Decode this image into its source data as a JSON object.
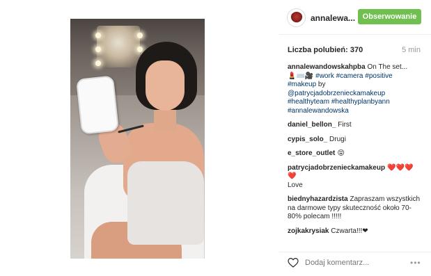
{
  "post": {
    "username": "annalewa...",
    "follow_label": "Obserwowanie",
    "likes_label": "Liczba polubień: 370",
    "time": "5 min",
    "caption": {
      "user": "annalewandowskahpba",
      "text_pre": " On The set...",
      "emojis": "💄⌨️🎥",
      "tags1": " #work #camera #positive",
      "tags2": "#makeup",
      "text_by": " by",
      "mention": "@patrycjadobrzenieckamakeup",
      "tags3": "#healthyteam #healthyplanbyann",
      "tags4": "#annalewandowska"
    },
    "comments": [
      {
        "user": "daniel_bellon_",
        "text": " First"
      },
      {
        "user": "cypis_solo_",
        "text": " Drugi"
      },
      {
        "user": "e_store_outlet",
        "text": " 😝"
      },
      {
        "user": "patrycjadobrzenieckamakeup",
        "text": " ❤️❤️❤️❤️",
        "text2": "Love"
      },
      {
        "user": "biednyhazardzista",
        "text": " Zapraszam wszystkich na darmowe typy skuteczność około 70-80% polecam !!!!!"
      },
      {
        "user": "zojkakrysiak",
        "text": " Czwarta!!!❤"
      }
    ],
    "add_comment_placeholder": "Dodaj komentarz...",
    "more_label": "•••"
  },
  "icons": {
    "like": "heart-outline-icon",
    "more": "more-options-icon"
  },
  "colors": {
    "follow_button": "#70c050",
    "hashtag": "#003569",
    "muted": "#999999"
  }
}
